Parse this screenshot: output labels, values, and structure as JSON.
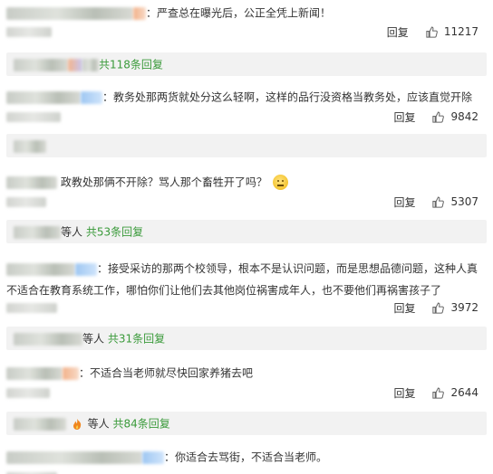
{
  "comments": [
    {
      "text": "：严查总在曝光后，公正全凭上新闻！",
      "reply_label": "回复",
      "likes": "11217",
      "replies": {
        "who": "",
        "count": "共118条回复"
      }
    },
    {
      "text": "：教务处那两货就处分这么轻啊，这样的品行没资格当教务处，应该直觉开除",
      "reply_label": "回复",
      "likes": "9842",
      "replies": {
        "who": "",
        "count": ""
      }
    },
    {
      "text": "政教处那俩不开除？骂人那个畜牲开了吗？",
      "reply_label": "回复",
      "likes": "5307",
      "replies": {
        "who": "等人",
        "count": "共53条回复"
      }
    },
    {
      "text": "：接受采访的那两个校领导，根本不是认识问题，而是思想品德问题，这种人真不适合在教育系统工作，哪怕你们让他们去其他岗位祸害成年人，也不要他们再祸害孩子了",
      "reply_label": "回复",
      "likes": "3972",
      "replies": {
        "who": "等人",
        "count": "共31条回复"
      }
    },
    {
      "text": "：不适合当老师就尽快回家养猪去吧",
      "reply_label": "回复",
      "likes": "2644",
      "replies": {
        "who": "等人",
        "count": "共84条回复"
      }
    },
    {
      "text": "：你适合去骂街，不适合当老师。",
      "reply_label": "",
      "likes": "",
      "replies": {
        "who": "",
        "count": ""
      }
    }
  ],
  "icons": {
    "like": "thumbs-up-icon",
    "emoji": "speechless-face-icon",
    "fire": "fire-icon"
  },
  "colors": {
    "reply_count": "#3a9a3a",
    "reply_bg": "#f2f2f2",
    "text": "#333333"
  }
}
